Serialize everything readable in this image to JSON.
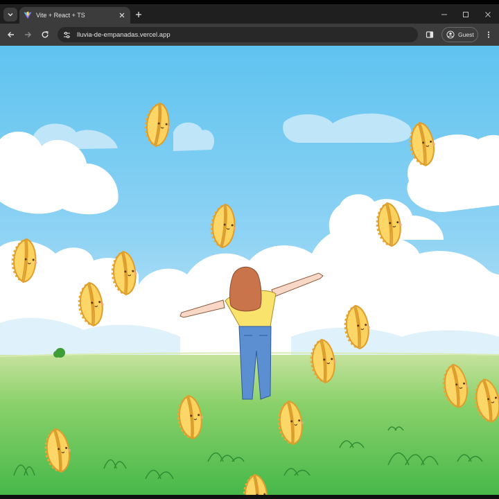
{
  "browser": {
    "tab": {
      "title": "Vite + React + TS"
    },
    "address_bar": {
      "url": "lluvia-de-empanadas.vercel.app"
    },
    "profile": {
      "label": "Guest"
    },
    "icons": {
      "tab_search": "chevron-down-icon",
      "favicon": "vite-logo-icon",
      "close_tab": "close-icon",
      "new_tab": "plus-icon",
      "minimize": "minimize-icon",
      "maximize": "maximize-icon",
      "close_window": "close-icon",
      "back": "arrow-left-icon",
      "forward": "arrow-right-icon",
      "reload": "reload-icon",
      "site_info": "tune-icon",
      "side_panel": "side-panel-icon",
      "profile": "person-icon",
      "menu": "kebab-menu-icon"
    },
    "colors": {
      "frame": "#1f1f1f",
      "toolbar": "#3c3c3c",
      "omnibox": "#282828",
      "text": "#e3e3e3"
    }
  },
  "scene": {
    "description_colors": {
      "sky_top": "#5ec3ef",
      "sky_bottom": "#bfe6f8",
      "grass_top": "#b8dc8a",
      "grass_bottom": "#4fbf4a",
      "empanada": "#fbd25e",
      "empanada_edge": "#e3a93a"
    },
    "girl": {
      "hair": "#c9744a",
      "shirt": "#fae36d",
      "jeans": "#5b8fd1"
    }
  }
}
